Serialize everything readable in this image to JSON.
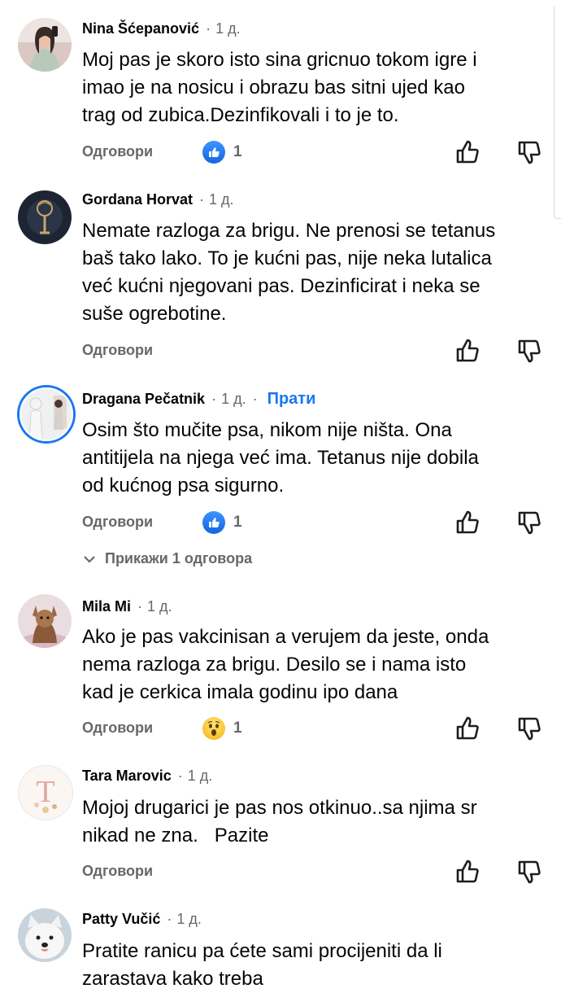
{
  "comments": [
    {
      "name": "Nina Šćepanović",
      "time": "1 д.",
      "lines": [
        "Moj pas je skoro isto sina gricnuo tokom igre i",
        "imao je na nosicu i obrazu bas sitni ujed kao",
        "trag od zubica.Dezinfikovali i to je to."
      ],
      "reply_label": "Одговори",
      "reaction": {
        "type": "like",
        "count": "1"
      }
    },
    {
      "name": "Gordana Horvat",
      "time": "1 д.",
      "lines": [
        "Nemate razloga za brigu. Ne prenosi se tetanus",
        "baš tako lako. To je kućni pas, nije neka lutalica",
        "već kućni njegovani pas. Dezinficirat i neka se",
        "suše ogrebotine."
      ],
      "reply_label": "Одговори"
    },
    {
      "name": "Dragana Pečatnik",
      "time": "1 д.",
      "follow": "Прати",
      "lines": [
        "Osim što mučite psa, nikom nije ništa. Ona",
        "antitijela na njega već ima. Tetanus nije dobila",
        "od kućnog psa sigurno."
      ],
      "reply_label": "Одговори",
      "reaction": {
        "type": "like",
        "count": "1"
      },
      "view_replies": "Прикажи 1 одговора"
    },
    {
      "name": "Mila Mi",
      "time": "1 д.",
      "lines": [
        "Ako je pas vakcinisan a verujem da jeste, onda",
        "nema razloga za brigu. Desilo se i nama isto",
        "kad je cerkica imala godinu ipo dana"
      ],
      "reply_label": "Одговори",
      "reaction": {
        "type": "wow",
        "count": "1"
      }
    },
    {
      "name": "Tara Marovic",
      "time": "1 д.",
      "lines": [
        "Mojoj drugarici je pas nos otkinuo..sa njima sr",
        "nikad ne zna.   Pazite"
      ],
      "reply_label": "Одговори"
    },
    {
      "name": "Patty Vučić",
      "time": "1 д.",
      "lines": [
        "Pratite ranicu pa ćete sami procijeniti da li",
        "zarastava kako treba"
      ]
    }
  ],
  "colors": {
    "accent": "#1877f2",
    "secondary_text": "#65676b",
    "primary_text": "#050505"
  },
  "icons": {
    "like": "thumbs-up-icon",
    "dislike": "thumbs-down-icon",
    "chevron": "chevron-down-icon"
  }
}
